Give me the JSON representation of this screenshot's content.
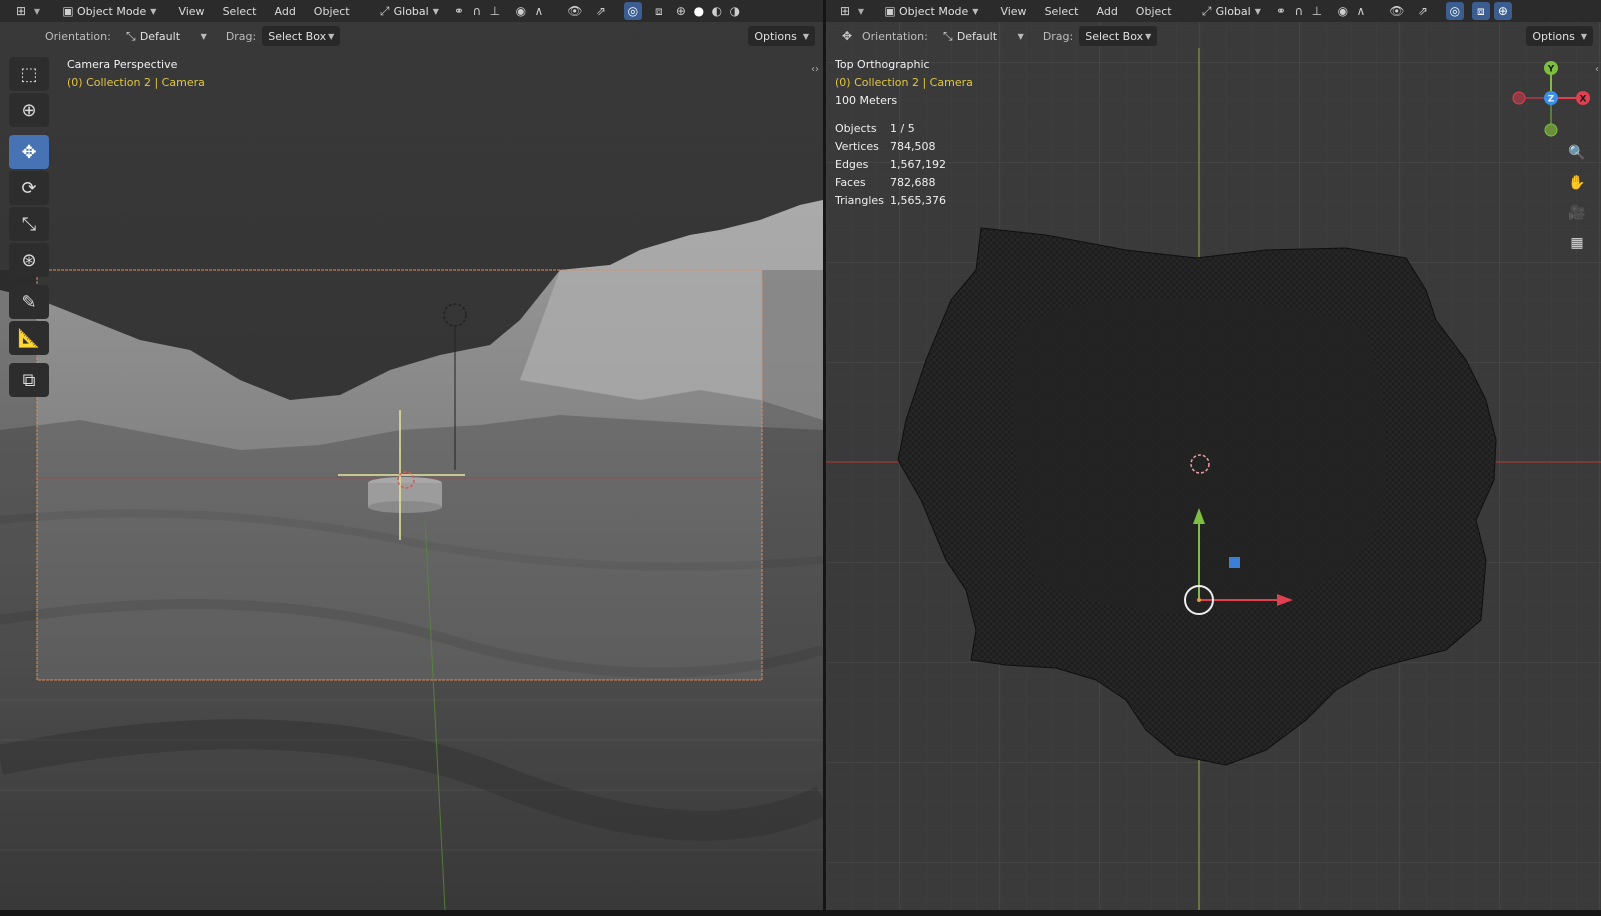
{
  "left": {
    "header": {
      "mode": "Object Mode",
      "menus": [
        "View",
        "Select",
        "Add",
        "Object"
      ],
      "transform_orientation": "Global"
    },
    "tool_header": {
      "orientation_label": "Orientation:",
      "orientation_value": "Default",
      "drag_label": "Drag:",
      "drag_value": "Select Box",
      "options": "Options"
    },
    "view_name": "Camera Perspective",
    "collection": "(0) Collection 2 | Camera"
  },
  "right": {
    "header": {
      "mode": "Object Mode",
      "menus": [
        "View",
        "Select",
        "Add",
        "Object"
      ],
      "transform_orientation": "Global"
    },
    "tool_header": {
      "orientation_label": "Orientation:",
      "orientation_value": "Default",
      "drag_label": "Drag:",
      "drag_value": "Select Box",
      "options": "Options"
    },
    "view_name": "Top Orthographic",
    "collection": "(0) Collection 2 | Camera",
    "scale": "100 Meters",
    "stats": [
      {
        "label": "Objects",
        "value": "1 / 5"
      },
      {
        "label": "Vertices",
        "value": "784,508"
      },
      {
        "label": "Edges",
        "value": "1,567,192"
      },
      {
        "label": "Faces",
        "value": "782,688"
      },
      {
        "label": "Triangles",
        "value": "1,565,376"
      }
    ],
    "gizmo": {
      "x": "X",
      "y": "Y",
      "z": "Z"
    }
  },
  "colors": {
    "active_tool": "#4772b3",
    "selection_text": "#e0c840",
    "axis_x": "#e0404f",
    "axis_y": "#7fbf3f",
    "axis_z": "#3b8fe8"
  }
}
